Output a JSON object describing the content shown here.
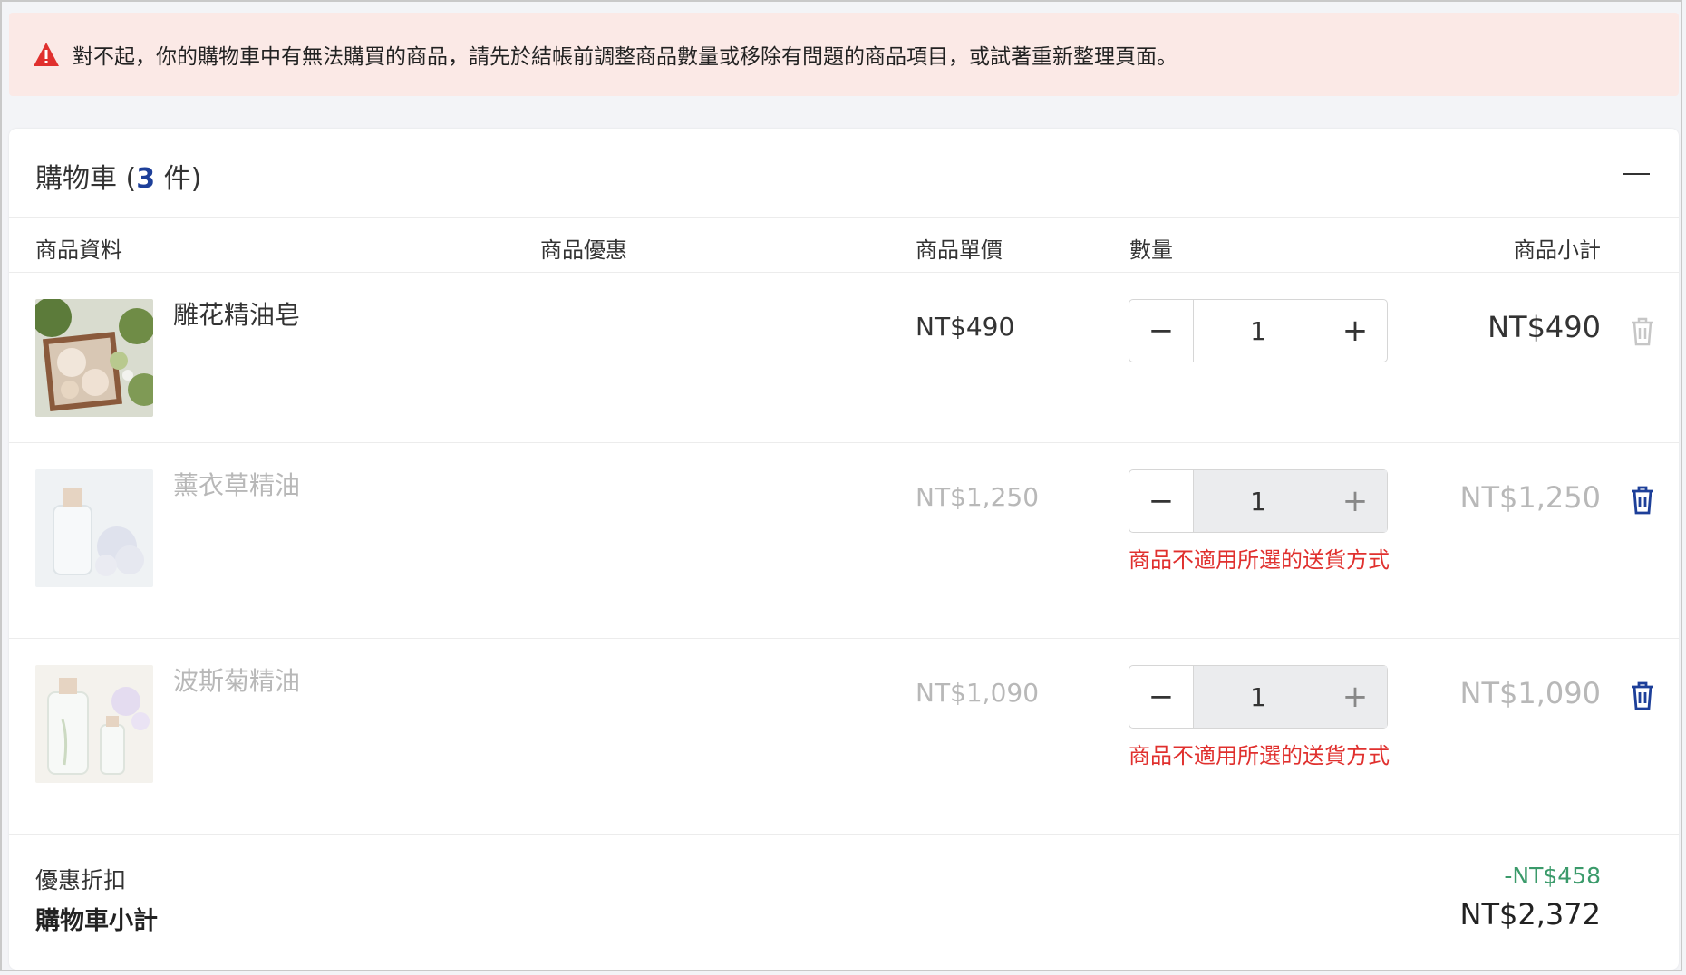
{
  "alert": {
    "icon": "warning-triangle-icon",
    "message": "對不起，你的購物車中有無法購買的商品，請先於結帳前調整商品數量或移除有問題的商品項目，或試著重新整理頁面。"
  },
  "cart": {
    "title_prefix": "購物車 (",
    "count": "3",
    "title_suffix": " 件)",
    "collapse_icon": "minus-icon",
    "columns": {
      "info": "商品資料",
      "promo": "商品優惠",
      "unit_price": "商品單價",
      "quantity": "數量",
      "subtotal": "商品小計"
    },
    "items": [
      {
        "name": "雕花精油皂",
        "price": "NT$490",
        "qty": "1",
        "subtotal": "NT$490",
        "error": "",
        "available": true
      },
      {
        "name": "薰衣草精油",
        "price": "NT$1,250",
        "qty": "1",
        "subtotal": "NT$1,250",
        "error": "商品不適用所選的送貨方式",
        "available": false
      },
      {
        "name": "波斯菊精油",
        "price": "NT$1,090",
        "qty": "1",
        "subtotal": "NT$1,090",
        "error": "商品不適用所選的送貨方式",
        "available": false
      }
    ],
    "discount_label": "優惠折扣",
    "discount_value": "-NT$458",
    "cart_subtotal_label": "購物車小計",
    "cart_subtotal_value": "NT$2,372"
  },
  "colors": {
    "accent": "#1d3f99",
    "error": "#e0302e",
    "discount": "#3a9a6a",
    "alert_bg": "#fbe9e6"
  },
  "qty_controls": {
    "minus": "−",
    "plus": "+"
  }
}
